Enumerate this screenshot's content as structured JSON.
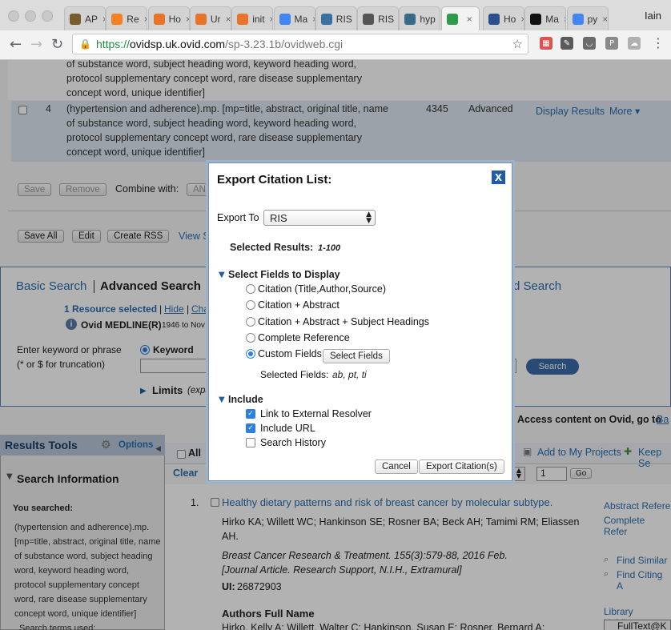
{
  "browser": {
    "tabs": [
      {
        "label": "AP",
        "icon": "ap-favicon-icon",
        "color": "#7a5b2b"
      },
      {
        "label": "Re",
        "icon": "stackoverflow-icon",
        "color": "#f48024"
      },
      {
        "label": "Ho",
        "icon": "orange-circle-icon",
        "color": "#e8742a"
      },
      {
        "label": "Ur",
        "icon": "orange-circle-icon",
        "color": "#e8742a"
      },
      {
        "label": "init",
        "icon": "orange-circle-icon",
        "color": "#e8742a"
      },
      {
        "label": "Ma",
        "icon": "google-docs-icon",
        "color": "#4285f4"
      },
      {
        "label": "RIS",
        "icon": "python-icon",
        "color": "#3872a3"
      },
      {
        "label": "RIS",
        "icon": "wikipedia-icon",
        "color": "#555555"
      },
      {
        "label": "hyp",
        "icon": "dna-icon",
        "color": "#3a6a8a"
      },
      {
        "label": "",
        "icon": "ovid-icon",
        "color": "#2e9b4a"
      },
      {
        "label": "Ho",
        "icon": "library-icon",
        "color": "#2d4f8e"
      },
      {
        "label": "Ma",
        "icon": "kofax-icon",
        "color": "#111111"
      },
      {
        "label": "py",
        "icon": "google-icon",
        "color": "#4285f4"
      }
    ],
    "user": "Iain",
    "url_https": "https://",
    "url_host": "ovidsp.uk.ovid.com",
    "url_path": "/sp-3.23.1b/ovidweb.cgi"
  },
  "history": {
    "row3_lines": [
      "of substance word, subject heading word, keyword heading word,",
      "protocol supplementary concept word, rare disease supplementary",
      "concept word, unique identifier]"
    ],
    "row4": {
      "num": "4",
      "lines": [
        "(hypertension and adherence).mp. [mp=title, abstract, original title, name",
        "of substance word, subject heading word, keyword heading word,",
        "protocol supplementary concept word, rare disease supplementary",
        "concept word, unique identifier]"
      ],
      "count": "4345",
      "type": "Advanced",
      "display": "Display Results",
      "more": "More ▾"
    },
    "save": "Save",
    "remove": "Remove",
    "combine": "Combine with:",
    "and": "AN",
    "save_all": "Save All",
    "edit": "Edit",
    "create_rss": "Create RSS",
    "view": "View S"
  },
  "search": {
    "basic": "Basic Search",
    "advanced": "Advanced Search",
    "right_tab": "d Search",
    "resource": "1 Resource selected",
    "hide": "Hide",
    "change": "Cha",
    "db": "Ovid MEDLINE(R)",
    "db_years": "1946 to Nov",
    "enter_kw": "Enter keyword or phrase",
    "truncation": "(* or $ for truncation)",
    "keyword": "Keyword",
    "search_btn": "Search",
    "limits": "Limits",
    "limits_expand": "(expa",
    "access": "Access content on Ovid, go to",
    "access_link": "Ba"
  },
  "results_tools": {
    "title": "Results Tools",
    "options": "Options",
    "all": "All",
    "clear": "Clear",
    "add_projects": "Add to My Projects",
    "keep": "Keep Se",
    "page_input": "1",
    "go": "Go"
  },
  "search_info": {
    "title": "Search Information",
    "you_searched": "You searched:",
    "query_lines": [
      "(hypertension and adherence).mp.",
      "[mp=title, abstract, original title, name",
      "of substance word, subject heading",
      "word, keyword heading word,",
      "protocol supplementary concept",
      "word, rare disease supplementary",
      "concept word, unique identifier]"
    ],
    "terms": "Search terms used:"
  },
  "result1": {
    "num": "1.",
    "title": "Healthy dietary patterns and risk of breast cancer by molecular subtype.",
    "authors_line1": "Hirko KA; Willett WC; Hankinson SE; Rosner BA; Beck AH; Tamimi RM; Eliassen",
    "authors_line2": "AH.",
    "journal": "Breast Cancer Research & Treatment. 155(3):579-88, 2016 Feb.",
    "pubtype": "[Journal Article. Research Support, N.I.H., Extramural]",
    "ui_label": "UI:",
    "ui_value": "26872903",
    "afn_title": "Authors Full Name",
    "afn_value": "Hirko, Kelly A; Willett, Walter C; Hankinson, Susan E; Rosner, Bernard A;",
    "abstract_ref": "Abstract Refere",
    "complete_ref": "Complete Refer",
    "find_similar": "Find Similar",
    "find_citing": "Find Citing A",
    "library": "Library Holdings",
    "fulltext": "FullText@K"
  },
  "modal": {
    "title": "Export Citation List:",
    "close": "X",
    "export_to": "Export To",
    "format": "RIS",
    "selected_results_label": "Selected Results:",
    "selected_results_value": "1-100",
    "fields_heading": "Select Fields to Display",
    "field_options": [
      "Citation (Title,Author,Source)",
      "Citation + Abstract",
      "Citation + Abstract + Subject Headings",
      "Complete Reference",
      "Custom Fields"
    ],
    "selected_field_index": 4,
    "select_fields_btn": "Select Fields",
    "selected_fields_label": "Selected Fields:",
    "selected_fields_value": "ab, pt, ti",
    "include_heading": "Include",
    "include_options": [
      {
        "label": "Link to External Resolver",
        "checked": true
      },
      {
        "label": "Include URL",
        "checked": true
      },
      {
        "label": "Search History",
        "checked": false
      }
    ],
    "cancel": "Cancel",
    "export_btn": "Export Citation(s)"
  }
}
